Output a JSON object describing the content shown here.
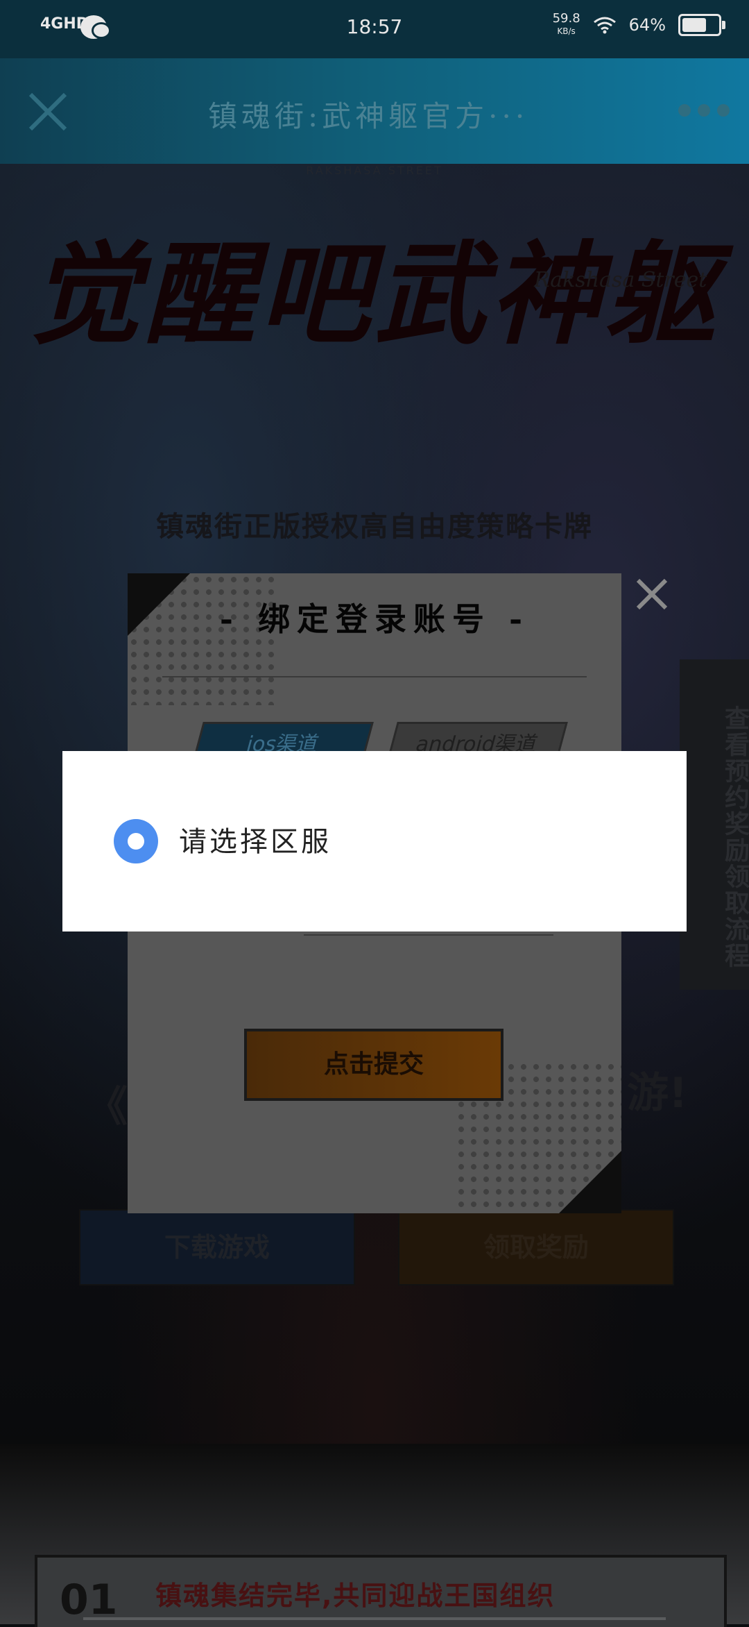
{
  "status_bar": {
    "network": "4GHD",
    "time": "18:57",
    "net_speed": "59.8",
    "net_speed_unit": "KB/s",
    "battery": "64%"
  },
  "header": {
    "title": "镇魂街:武神躯官方···"
  },
  "page": {
    "top_tag": "RAKSHASA STREET",
    "hero_title": "觉醒吧武神躯",
    "hero_brand": "Rakshasa Street",
    "hero_subtitle": "镇魂街正版授权高自由度策略卡牌",
    "reward_tab": "查看预约奖励领取流程",
    "promo_left": "《",
    "promo_right": "游!",
    "download_button": "下载游戏",
    "claim_button": "领取奖励",
    "bottom_number": "01",
    "bottom_text": "镇魂集结完毕,共同迎战王国组织"
  },
  "bind_modal": {
    "title": "- 绑定登录账号 -",
    "tab_ios": "ios渠道",
    "tab_android": "android渠道",
    "submit_label": "点击提交"
  },
  "region_dialog": {
    "option_label": "请选择区服",
    "selected": true,
    "accent_color": "#4d8ef0"
  }
}
